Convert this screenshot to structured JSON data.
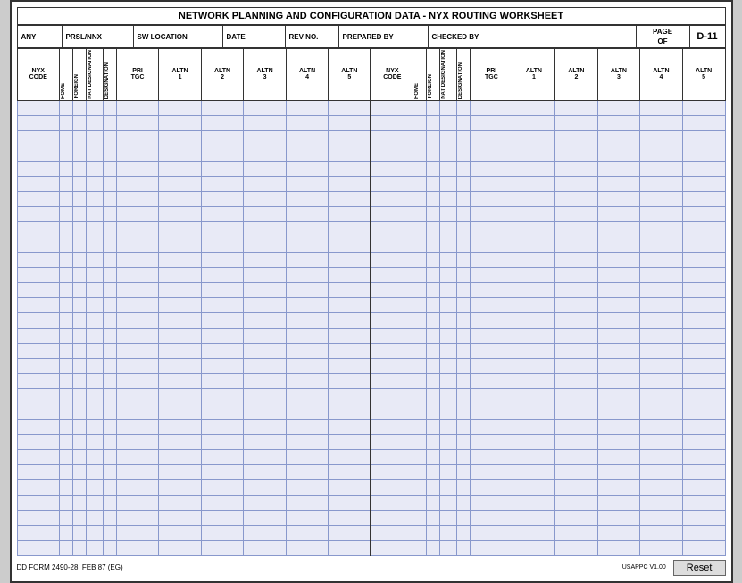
{
  "title": "NETWORK PLANNING AND CONFIGURATION DATA - NYX ROUTING WORKSHEET",
  "meta": {
    "any": "ANY",
    "prsl_nnx": "PRSL/NNX",
    "sw_location": "SW LOCATION",
    "date": "DATE",
    "rev_no": "REV NO.",
    "prepared_by": "PREPARED BY",
    "checked_by": "CHECKED BY",
    "page_label": "PAGE",
    "of_label": "OF",
    "page_number": "D-11"
  },
  "columns_left": [
    {
      "id": "nyx_code",
      "label": "NYX CODE",
      "type": "normal"
    },
    {
      "id": "home",
      "label": "HOME",
      "type": "vert"
    },
    {
      "id": "foreign",
      "label": "FOREIGN",
      "type": "vert"
    },
    {
      "id": "nat_designation",
      "label": "NAT DESIGNATION",
      "type": "vert"
    },
    {
      "id": "desig_nation",
      "label": "DESIGNATION",
      "type": "vert"
    },
    {
      "id": "pri_tgc",
      "label": "PRI TGC",
      "type": "normal"
    },
    {
      "id": "altn1",
      "label": "ALTN 1",
      "type": "normal"
    },
    {
      "id": "altn2",
      "label": "ALTN 2",
      "type": "normal"
    },
    {
      "id": "altn3",
      "label": "ALTN 3",
      "type": "normal"
    },
    {
      "id": "altn4",
      "label": "ALTN 4",
      "type": "normal"
    },
    {
      "id": "altn5",
      "label": "ALTN 5",
      "type": "normal"
    }
  ],
  "columns_right": [
    {
      "id": "nyx_code2",
      "label": "NYX CODE",
      "type": "normal"
    },
    {
      "id": "home2",
      "label": "HOME",
      "type": "vert"
    },
    {
      "id": "foreign2",
      "label": "FOREIGN",
      "type": "vert"
    },
    {
      "id": "nat_desig2",
      "label": "NAT DESIGNATION",
      "type": "vert"
    },
    {
      "id": "desig2",
      "label": "DESIGNATION",
      "type": "vert"
    },
    {
      "id": "pri_tgc2",
      "label": "PRI TGC",
      "type": "normal"
    },
    {
      "id": "altn1b",
      "label": "ALTN 1",
      "type": "normal"
    },
    {
      "id": "altn2b",
      "label": "ALTN 2",
      "type": "normal"
    },
    {
      "id": "altn3b",
      "label": "ALTN 3",
      "type": "normal"
    },
    {
      "id": "altn4b",
      "label": "ALTN 4",
      "type": "normal"
    },
    {
      "id": "altn5b",
      "label": "ALTN 5",
      "type": "normal"
    }
  ],
  "num_data_rows": 30,
  "footer": {
    "form_label": "DD FORM 2490-28, FEB 87 (EG)",
    "usappc": "USAPPC V1.00",
    "reset_button": "Reset"
  }
}
